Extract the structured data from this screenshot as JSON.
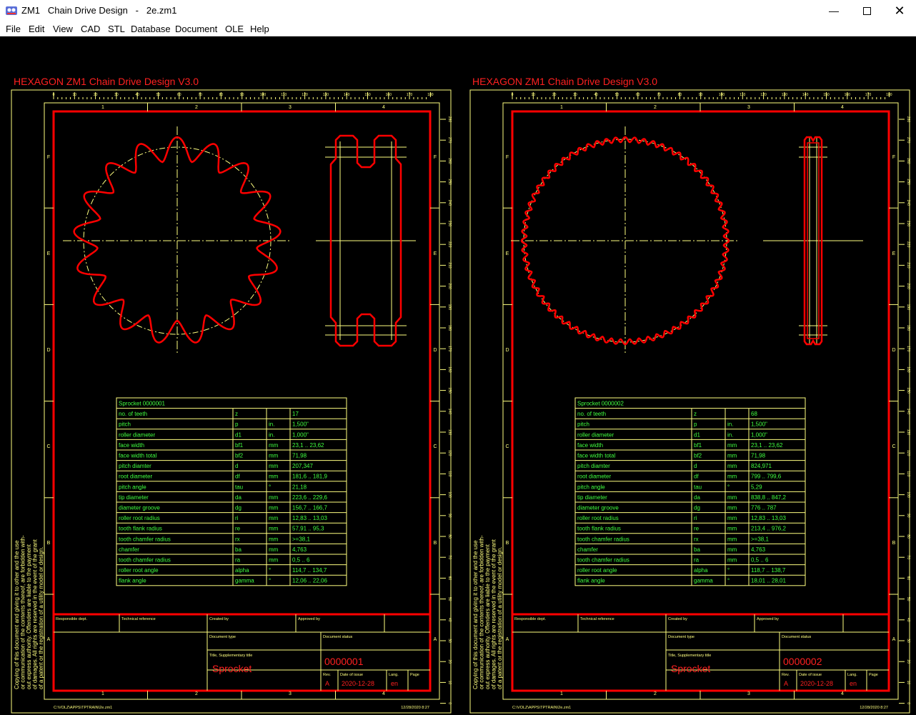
{
  "window": {
    "app": "ZM1",
    "title": "Chain Drive Design",
    "file": "2e.zm1"
  },
  "menu": [
    "File",
    "Edit",
    "View",
    "CAD",
    "STL",
    "Database",
    "Document",
    "OLE",
    "Help"
  ],
  "colors": {
    "background": "#000000",
    "frame": "#ffff80",
    "border": "#ff0000",
    "text_green": "#40ff40",
    "text_yellow": "#ffff80",
    "text_red": "#ff2020"
  },
  "sheets": [
    {
      "header": "HEXAGON   ZM1   Chain Drive Design  V3.0",
      "table_title": "Sprocket  0000001",
      "teeth_drawn": 17,
      "rows": [
        [
          "no. of teeth",
          "z",
          "",
          "17"
        ],
        [
          "pitch",
          "p",
          "in.",
          "1,500\""
        ],
        [
          "roller diameter",
          "d1",
          "in.",
          "1,000\""
        ],
        [
          "face width",
          "bf1",
          "mm",
          "23,1 .. 23,62"
        ],
        [
          "face width total",
          "bf2",
          "mm",
          "71,98"
        ],
        [
          "pitch diamter",
          "d",
          "mm",
          "207,347"
        ],
        [
          "root diameter",
          "df",
          "mm",
          "181,6 .. 181,9"
        ],
        [
          "pitch angle",
          "tau",
          "°",
          "21,18"
        ],
        [
          "tip diameter",
          "da",
          "mm",
          "223,6 .. 229,6"
        ],
        [
          "diameter groove",
          "dg",
          "mm",
          "156,7 .. 166,7"
        ],
        [
          "roller root radius",
          "ri",
          "mm",
          "12,83 .. 13,03"
        ],
        [
          "tooth flank radius",
          "re",
          "mm",
          "57,91 .. 95,3"
        ],
        [
          "tooth chamfer radius",
          "rx",
          "mm",
          ">=38,1"
        ],
        [
          "chamfer",
          "ba",
          "mm",
          "4,763"
        ],
        [
          "tooth chamfer radius",
          "ra",
          "mm",
          "0,5 .. 6"
        ],
        [
          "roller root angle",
          "alpha",
          "°",
          "114,7 .. 134,7"
        ],
        [
          "flank angle",
          "gamma",
          "°",
          "12,06 .. 22,06"
        ]
      ],
      "title_block": {
        "responsible": "Responsible dept.",
        "technical": "Technical reference",
        "created": "Created by",
        "approved": "Approved by",
        "doc_type": "Document type",
        "doc_status": "Document status",
        "title_label": "Title, Supplementary title",
        "title": "Sprocket",
        "number": "0000001",
        "rev_label": "Rev.",
        "rev": "A",
        "date_label": "Date of issue",
        "date": "2020-12-28",
        "lang_label": "Lang.",
        "lang": "en",
        "page_label": "Page"
      },
      "footer_path": "C:\\VOLZ\\APPS\\TPTRAIN\\2e.zm1",
      "footer_time": "12/28/2020 8:27"
    },
    {
      "header": "HEXAGON   ZM1   Chain Drive Design  V3.0",
      "table_title": "Sprocket  0000002",
      "teeth_drawn": 68,
      "rows": [
        [
          "no. of teeth",
          "z",
          "",
          "68"
        ],
        [
          "pitch",
          "p",
          "in.",
          "1,500\""
        ],
        [
          "roller diameter",
          "d1",
          "in.",
          "1,000\""
        ],
        [
          "face width",
          "bf1",
          "mm",
          "23,1 .. 23,62"
        ],
        [
          "face width total",
          "bf2",
          "mm",
          "71,98"
        ],
        [
          "pitch diamter",
          "d",
          "mm",
          "824,971"
        ],
        [
          "root diameter",
          "df",
          "mm",
          "799 .. 799,6"
        ],
        [
          "pitch angle",
          "tau",
          "°",
          "5,29"
        ],
        [
          "tip diameter",
          "da",
          "mm",
          "838,8 .. 847,2"
        ],
        [
          "diameter groove",
          "dg",
          "mm",
          "776 .. 787"
        ],
        [
          "roller root radius",
          "ri",
          "mm",
          "12,83 .. 13,03"
        ],
        [
          "tooth flank radius",
          "re",
          "mm",
          "213,4 .. 976,2"
        ],
        [
          "tooth chamfer radius",
          "rx",
          "mm",
          ">=38,1"
        ],
        [
          "chamfer",
          "ba",
          "mm",
          "4,763"
        ],
        [
          "tooth chamfer radius",
          "ra",
          "mm",
          "0,5 .. 6"
        ],
        [
          "roller root angle",
          "alpha",
          "°",
          "118,7 .. 138,7"
        ],
        [
          "flank angle",
          "gamma",
          "°",
          "18,01 .. 28,01"
        ]
      ],
      "title_block": {
        "responsible": "Responsible dept.",
        "technical": "Technical reference",
        "created": "Created by",
        "approved": "Approved by",
        "doc_type": "Document type",
        "doc_status": "Document status",
        "title_label": "Title, Supplementary title",
        "title": "Sprocket",
        "number": "0000002",
        "rev_label": "Rev.",
        "rev": "A",
        "date_label": "Date of issue",
        "date": "2020-12-28",
        "lang_label": "Lang.",
        "lang": "en",
        "page_label": "Page"
      },
      "footer_path": "C:\\VOLZ\\APPS\\TPTRAIN\\2e.zm1",
      "footer_time": "12/28/2020 8:27"
    }
  ],
  "ruler_top": [
    "0",
    "10",
    "20",
    "30",
    "40",
    "50",
    "60",
    "70",
    "80",
    "90",
    "100",
    "110",
    "120",
    "130",
    "140",
    "150",
    "160",
    "170",
    "180"
  ],
  "ruler_side": [
    "280",
    "270",
    "260",
    "250",
    "240",
    "230",
    "220",
    "210",
    "200",
    "190",
    "180",
    "170",
    "160",
    "150",
    "140",
    "130",
    "120",
    "110",
    "100",
    "90",
    "80",
    "70",
    "60",
    "50",
    "40",
    "30",
    "20",
    "10",
    "0"
  ],
  "zones_cols": [
    "1",
    "2",
    "3",
    "4"
  ],
  "zones_rows": [
    "F",
    "E",
    "D",
    "C",
    "B",
    "A"
  ],
  "copyright": [
    "Copying of this document and giving it to other and the use",
    "or communication of the contents thereof, are forbidden with-",
    "out express authority. Offenders are liable to the payment",
    "of damages. All rights are reserved in the event of the grant",
    "of a patent or the registration of a utility model or design."
  ]
}
